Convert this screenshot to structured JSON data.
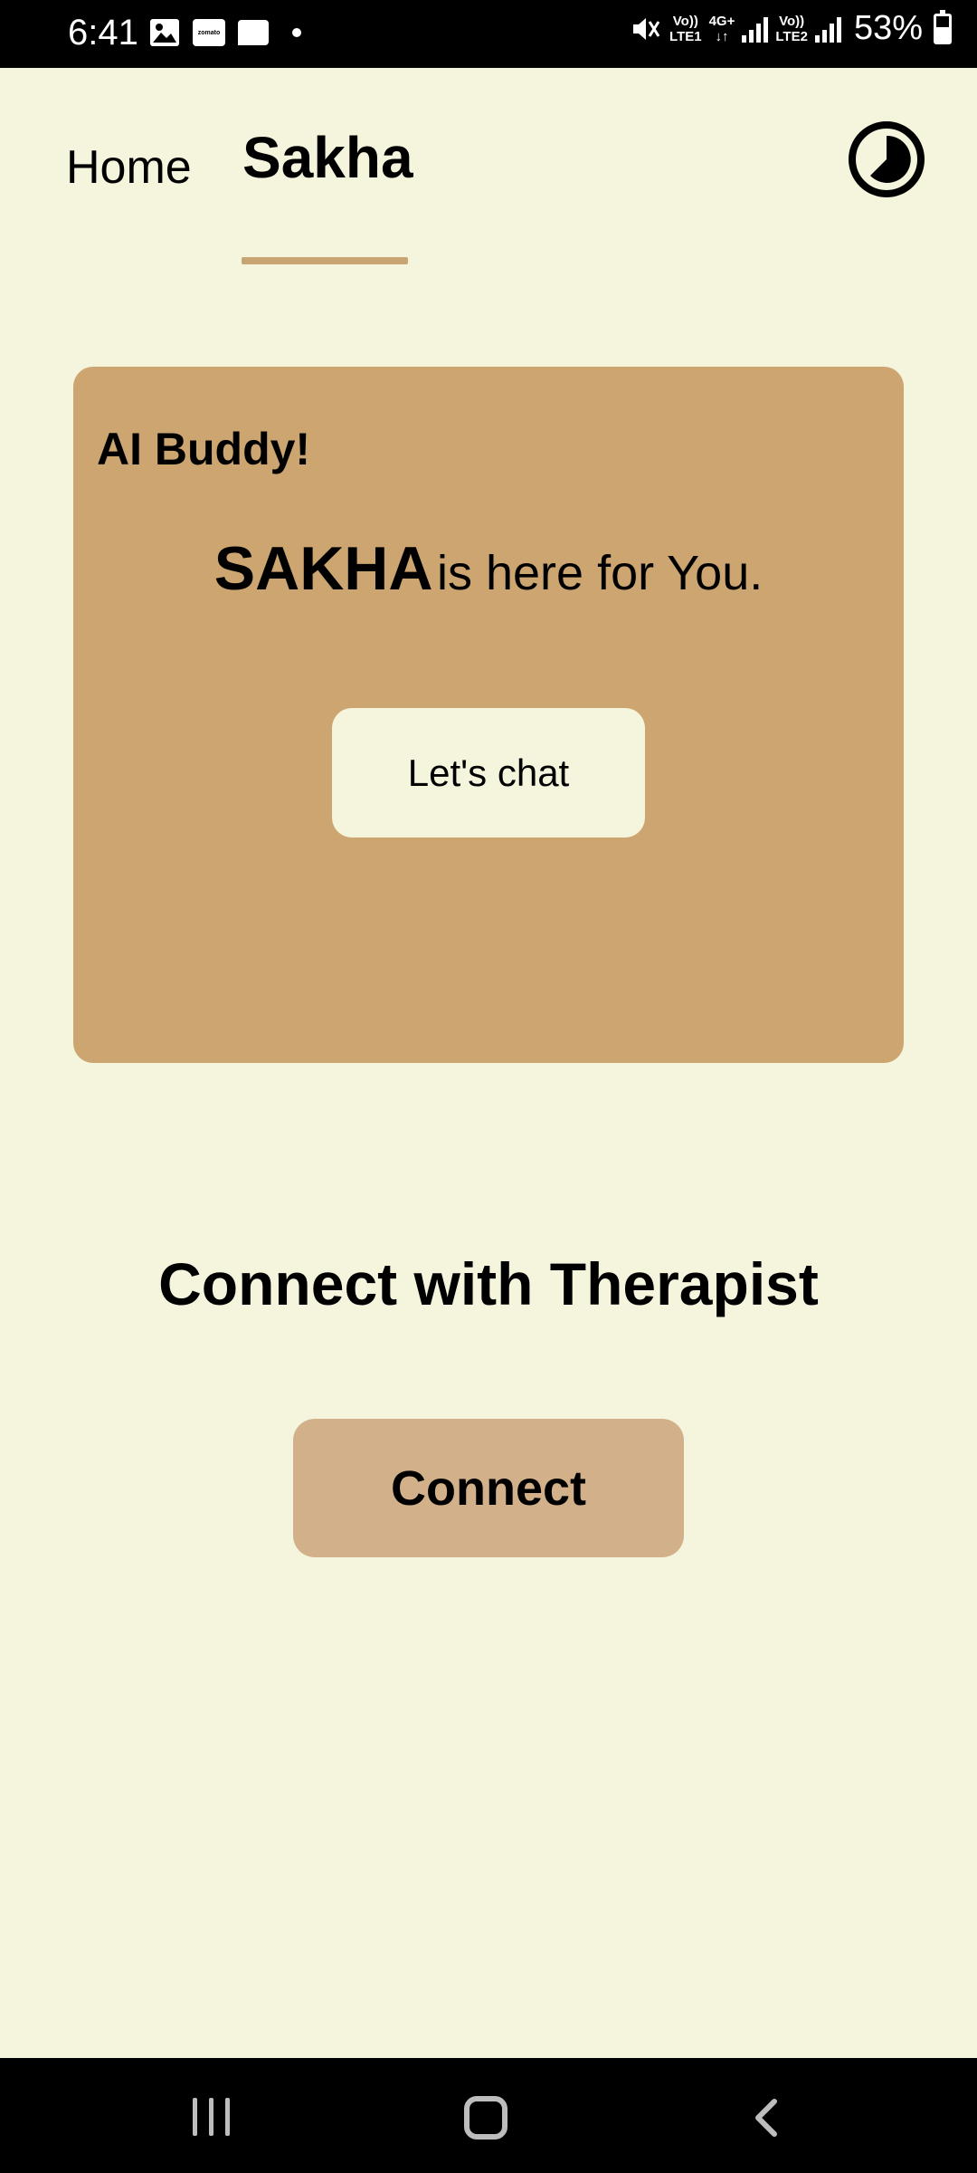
{
  "status_bar": {
    "time": "6:41",
    "left_icons": [
      "gallery-icon",
      "zomato-icon",
      "message-icon",
      "dot-icon"
    ],
    "zomato_text": "zomato",
    "sim1_label_top": "Vo))",
    "sim1_label_bottom": "LTE1",
    "net_type_top": "4G+",
    "net_type_bottom": "↓↑",
    "sim2_label_top": "Vo))",
    "sim2_label_bottom": "LTE2",
    "battery": "53%"
  },
  "nav_tabs": {
    "home": "Home",
    "sakha": "Sakha",
    "active": "Sakha"
  },
  "ai_card": {
    "title": "AI Buddy!",
    "brand": "SAKHA",
    "tagline": "is here for You.",
    "button": "Let's chat"
  },
  "therapist": {
    "title": "Connect with Therapist",
    "button": "Connect"
  },
  "colors": {
    "background": "#f5f4dc",
    "card": "#cda570",
    "accent": "#c9a473",
    "connect_button": "#d2b18a"
  }
}
